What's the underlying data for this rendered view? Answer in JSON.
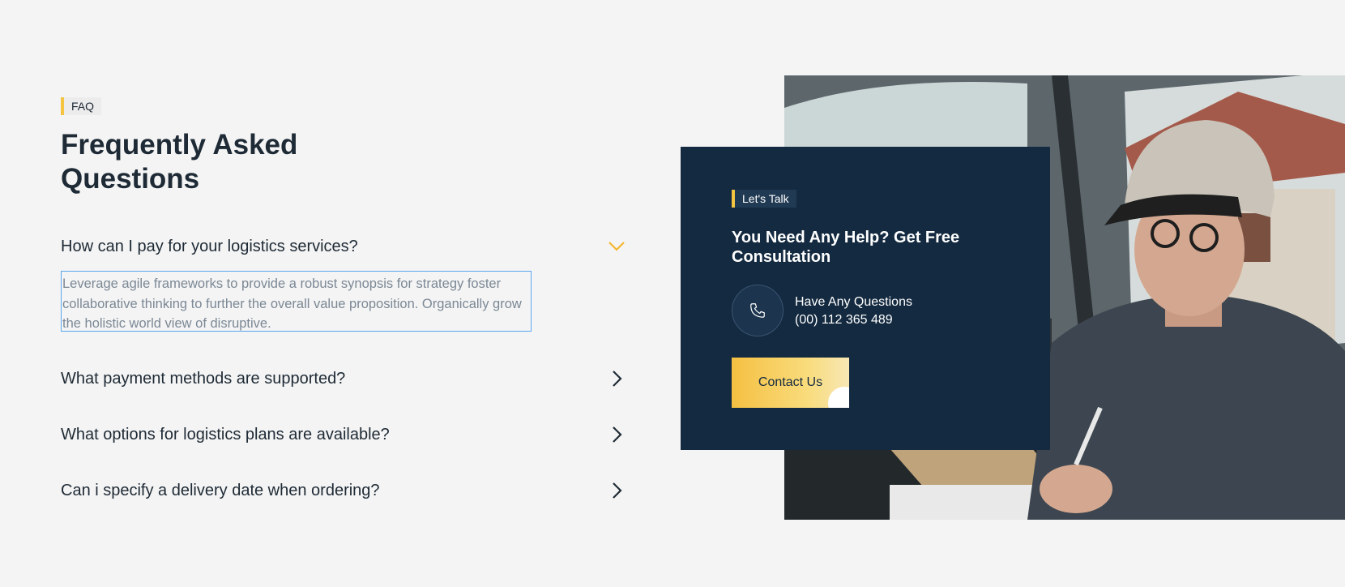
{
  "faq": {
    "tag": "FAQ",
    "title": "Frequently Asked Questions",
    "questions": [
      {
        "q": "How can I pay for your logistics services?",
        "expanded": true,
        "answer": "Leverage agile frameworks to provide a robust synopsis for strategy foster collaborative thinking to further the overall value proposition. Organically grow the holistic world view of disruptive."
      },
      {
        "q": "What payment methods are supported?",
        "expanded": false
      },
      {
        "q": "What options for logistics plans are available?",
        "expanded": false
      },
      {
        "q": "Can i specify a delivery date when ordering?",
        "expanded": false
      }
    ]
  },
  "contact_card": {
    "tag": "Let's Talk",
    "title": "You Need Any Help? Get Free Consultation",
    "question_label": "Have Any Questions",
    "phone": "(00) 112 365 489",
    "button_label": "Contact Us"
  },
  "photo": {
    "icon": "courier-photo"
  },
  "colors": {
    "accent": "#f5c542",
    "card_bg": "#142a40",
    "background": "#f4f4f4",
    "selection_border": "#5aa6f0"
  }
}
